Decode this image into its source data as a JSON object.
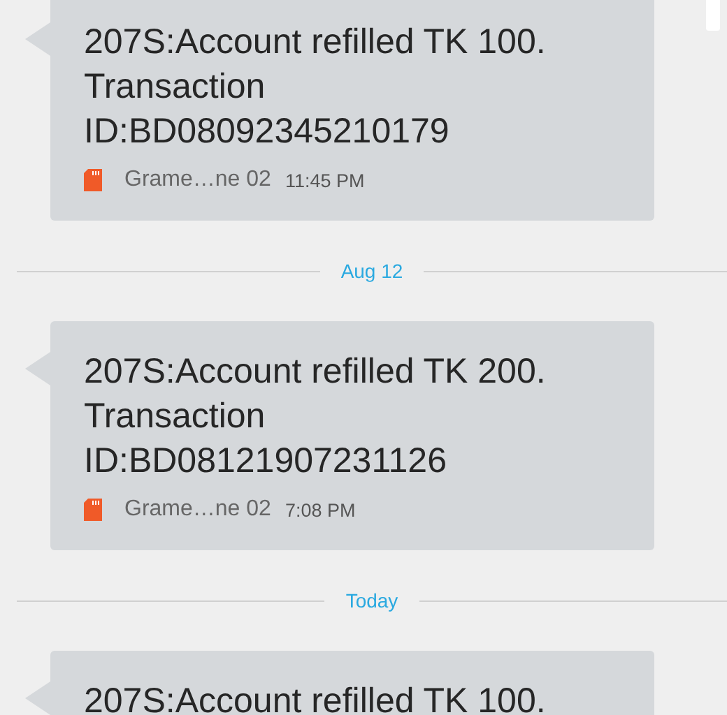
{
  "messages": [
    {
      "text": "207S:Account refilled TK 100. Transaction ID:BD08092345210179",
      "sim": "Grame…ne 02",
      "time": "11:45 PM"
    },
    {
      "text": "207S:Account refilled TK 200. Transaction ID:BD08121907231126",
      "sim": "Grame…ne 02",
      "time": "7:08 PM",
      "date_before": "Aug 12"
    },
    {
      "text": "207S:Account refilled TK 100.",
      "date_before": "Today"
    }
  ]
}
